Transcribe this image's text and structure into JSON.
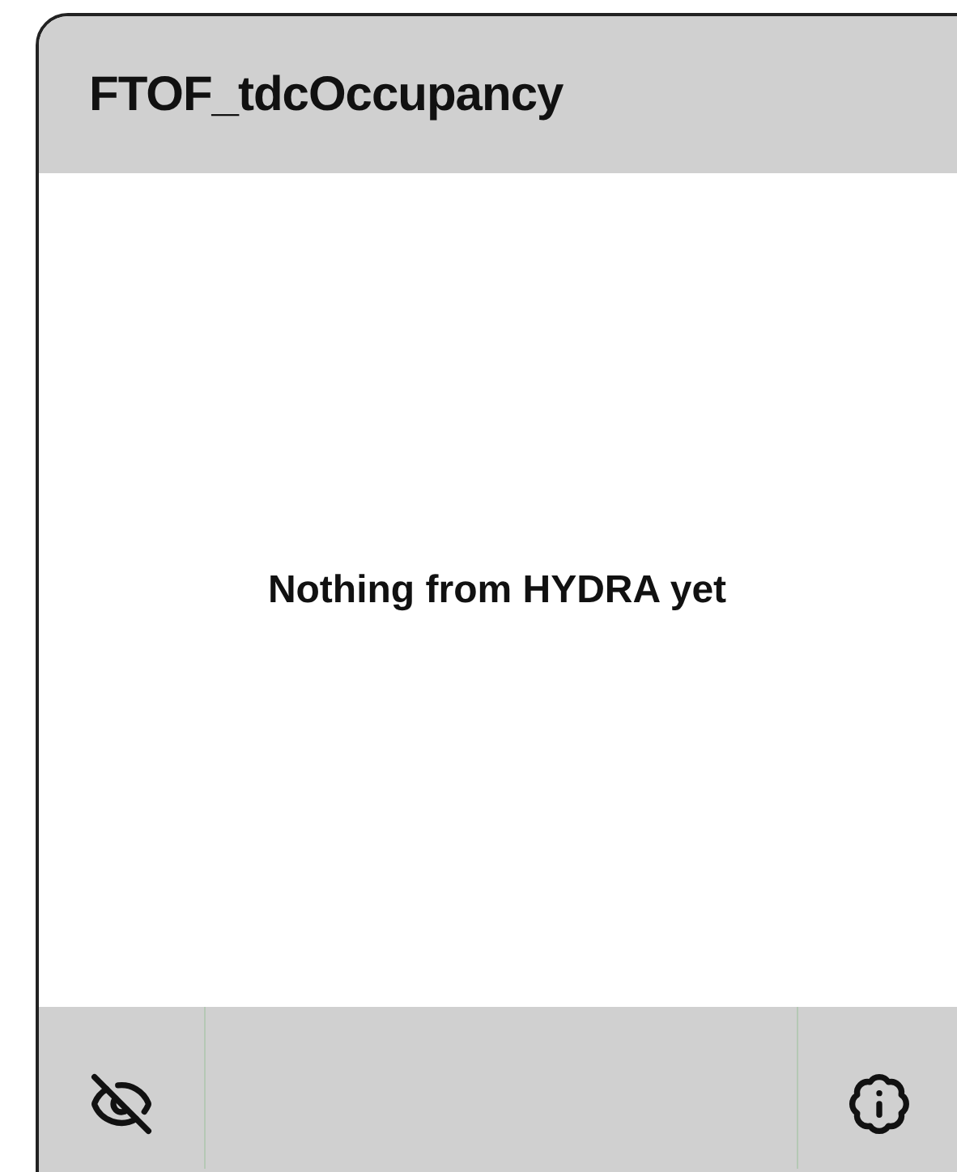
{
  "panel": {
    "title": "FTOF_tdcOccupancy",
    "message": "Nothing from HYDRA yet"
  }
}
